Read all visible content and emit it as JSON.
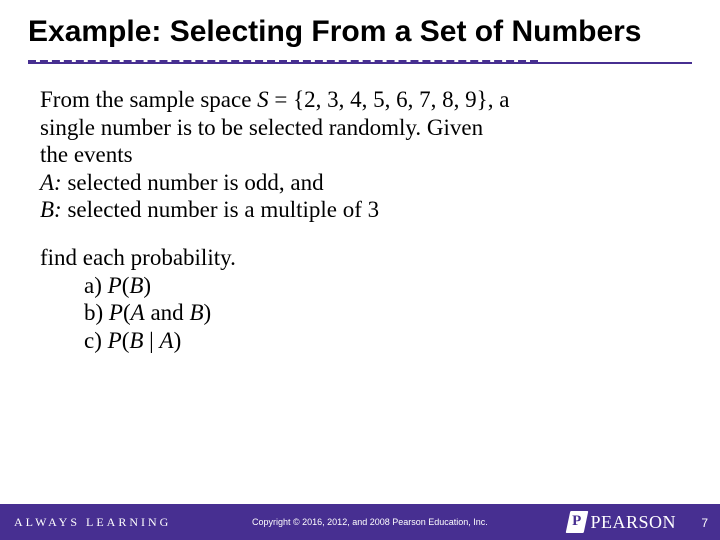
{
  "title": "Example: Selecting From a Set of Numbers",
  "para1": {
    "l1a": "From the sample space ",
    "var_S": "S",
    "l1b": " = {2, 3, 4, 5, 6, 7, 8, 9}, a",
    "l2": "single number is to be selected randomly. Given",
    "l3": "the events",
    "l4a": "A:",
    "l4b": " selected number is odd, and",
    "l5a": "B:",
    "l5b": " selected number is a multiple of 3"
  },
  "para2": {
    "lead": "find each probability.",
    "a_pre": "a)  ",
    "a_P": "P",
    "a_open": "(",
    "a_B": "B",
    "a_close": ")",
    "b_pre": "b)  ",
    "b_P": "P",
    "b_open": "(",
    "b_A": "A",
    "b_mid": " and ",
    "b_B": "B",
    "b_close": ")",
    "c_pre": "c)  ",
    "c_P": "P",
    "c_open": "(",
    "c_B": "B",
    "c_bar": " | ",
    "c_A": "A",
    "c_close": ")"
  },
  "footer": {
    "left": "ALWAYS LEARNING",
    "center": "Copyright © 2016, 2012, and 2008 Pearson Education, Inc.",
    "brand": "PEARSON",
    "page": "7"
  }
}
